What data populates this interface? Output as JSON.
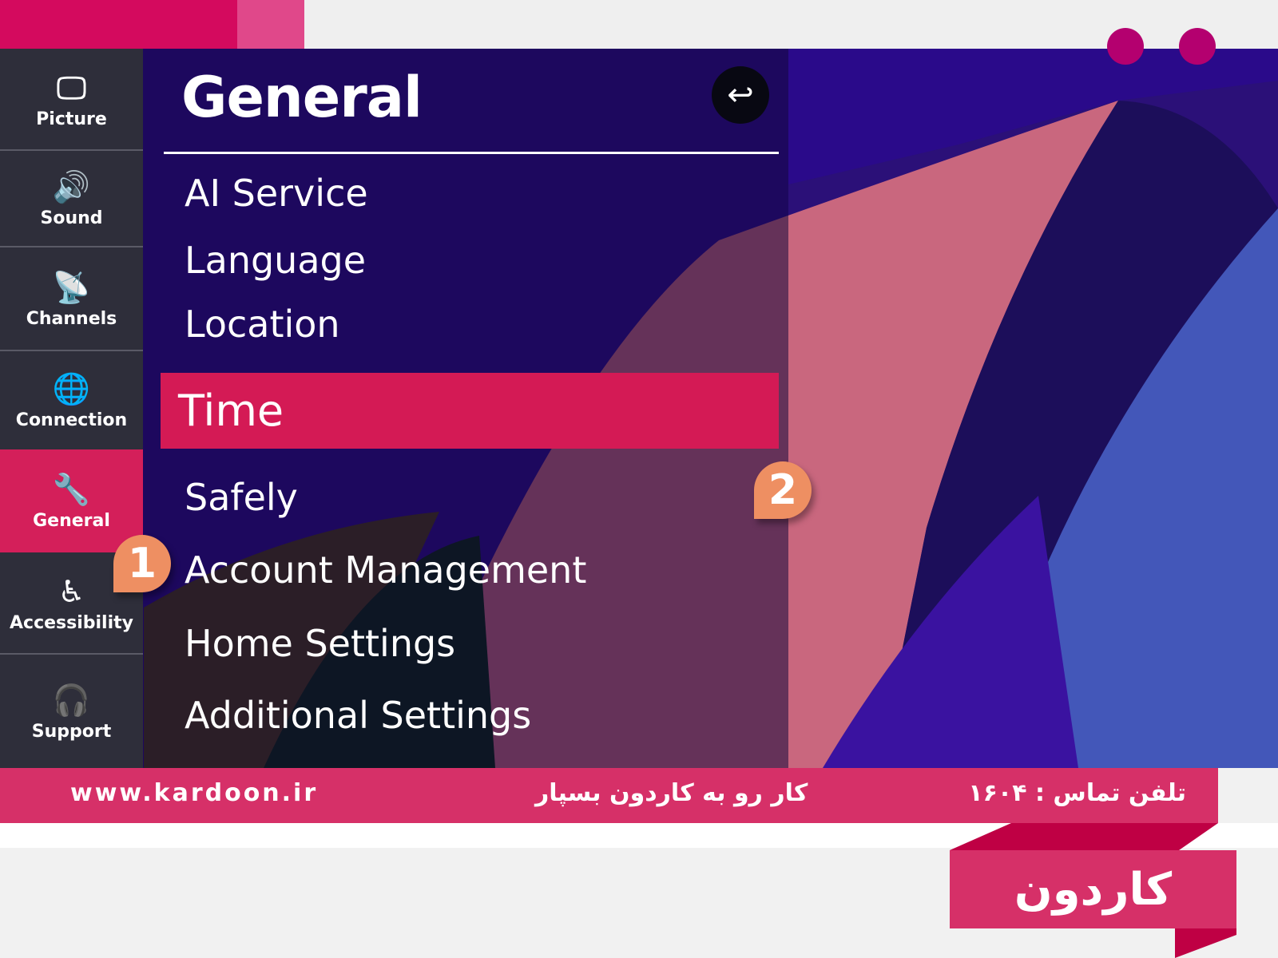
{
  "sidebar": {
    "items": [
      {
        "label": "Picture",
        "icon": "monitor-icon",
        "glyph": "🖵"
      },
      {
        "label": "Sound",
        "icon": "speaker-icon",
        "glyph": "🔊"
      },
      {
        "label": "Channels",
        "icon": "satellite-dish-icon",
        "glyph": "📡"
      },
      {
        "label": "Connection",
        "icon": "globe-icon",
        "glyph": "🌐"
      },
      {
        "label": "General",
        "icon": "wrench-icon",
        "glyph": "🔧",
        "active": true
      },
      {
        "label": "Accessibility",
        "icon": "accessibility-icon",
        "glyph": "♿"
      },
      {
        "label": "Support",
        "icon": "headset-icon",
        "glyph": "🎧"
      }
    ]
  },
  "panel": {
    "title": "General",
    "back_icon": "↩",
    "items": [
      "AI Service",
      "Language",
      "Location",
      "Time",
      "Safely",
      "Account Management",
      "Home Settings",
      "Additional Settings"
    ],
    "selected": "Time"
  },
  "badges": {
    "step1": "1",
    "step2": "2"
  },
  "footer": {
    "website": "www.kardoon.ir",
    "slogan": "کار رو به کاردون بسپار",
    "phone": "تلفن تماس : ۱۶۰۴"
  },
  "logo": {
    "text": "کاردون"
  },
  "colors": {
    "accent": "#d41f5a",
    "brand": "#d63068",
    "badge": "#ee8f62"
  }
}
